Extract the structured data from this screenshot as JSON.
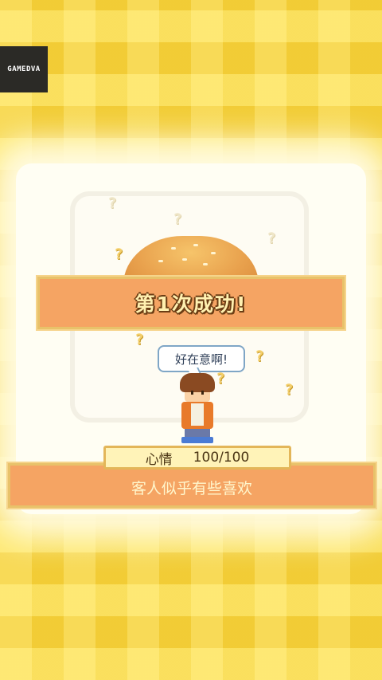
{
  "logo": {
    "text": "GAMEDVA"
  },
  "success": {
    "text": "第1次成功!"
  },
  "speech": {
    "text": "好在意啊!"
  },
  "mood": {
    "label": "心情",
    "value": "100/100"
  },
  "message": {
    "text": "客人似乎有些喜欢"
  },
  "icons": {
    "question": "question-mark-icon",
    "food": "burger-icon",
    "customer": "customer-sprite"
  }
}
